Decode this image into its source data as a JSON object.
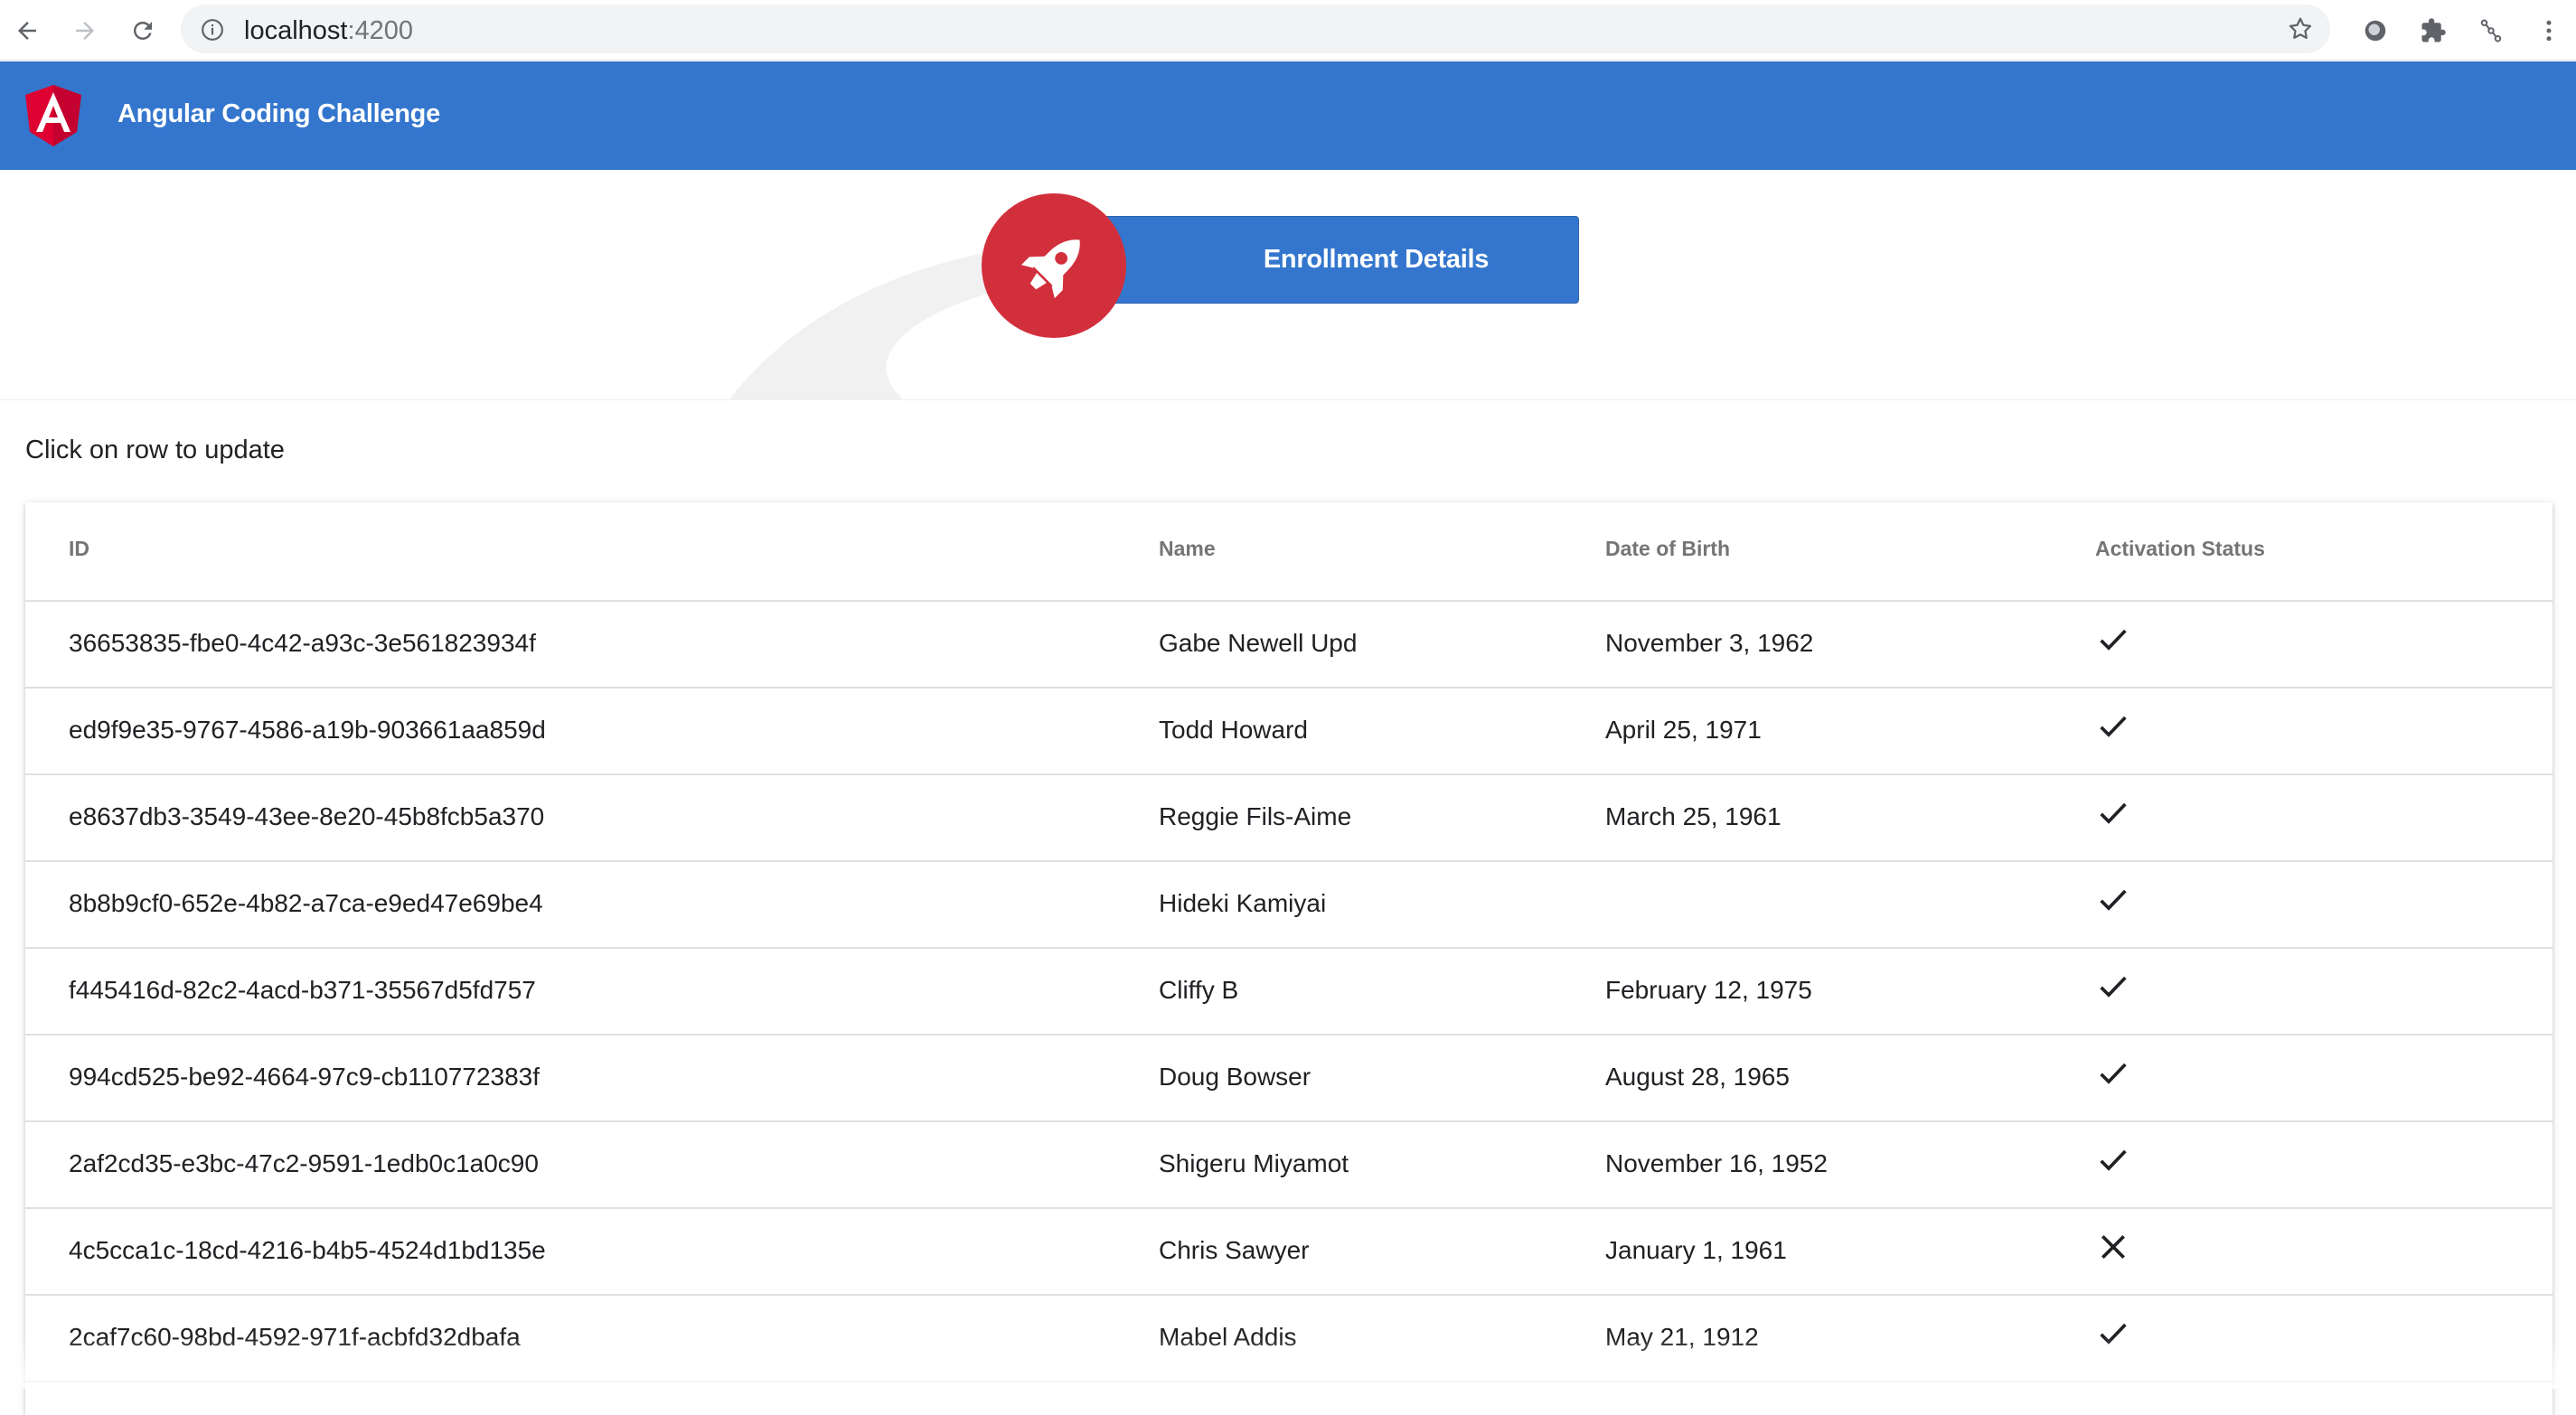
{
  "browser": {
    "url_host": "localhost",
    "url_port": ":4200"
  },
  "app": {
    "title": "Angular Coding Challenge",
    "logo_letter": "A",
    "brand_color": "#3476cd",
    "accent_color": "#d22f3c"
  },
  "hero": {
    "button_label": "Enrollment Details"
  },
  "hint": "Click on row to update",
  "table": {
    "headers": {
      "id": "ID",
      "name": "Name",
      "dob": "Date of Birth",
      "status": "Activation Status"
    },
    "rows": [
      {
        "id": "36653835-fbe0-4c42-a93c-3e561823934f",
        "name": "Gabe Newell Upd",
        "dob": "November 3, 1962",
        "active": true
      },
      {
        "id": "ed9f9e35-9767-4586-a19b-903661aa859d",
        "name": "Todd Howard",
        "dob": "April 25, 1971",
        "active": true
      },
      {
        "id": "e8637db3-3549-43ee-8e20-45b8fcb5a370",
        "name": "Reggie Fils-Aime",
        "dob": "March 25, 1961",
        "active": true
      },
      {
        "id": "8b8b9cf0-652e-4b82-a7ca-e9ed47e69be4",
        "name": "Hideki Kamiyai",
        "dob": "",
        "active": true
      },
      {
        "id": "f445416d-82c2-4acd-b371-35567d5fd757",
        "name": "Cliffy B",
        "dob": "February 12, 1975",
        "active": true
      },
      {
        "id": "994cd525-be92-4664-97c9-cb110772383f",
        "name": "Doug Bowser",
        "dob": "August 28, 1965",
        "active": true
      },
      {
        "id": "2af2cd35-e3bc-47c2-9591-1edb0c1a0c90",
        "name": "Shigeru Miyamot",
        "dob": "November 16, 1952",
        "active": true
      },
      {
        "id": "4c5cca1c-18cd-4216-b4b5-4524d1bd135e",
        "name": "Chris Sawyer",
        "dob": "January 1, 1961",
        "active": false
      },
      {
        "id": "2caf7c60-98bd-4592-971f-acbfd32dbafa",
        "name": "Mabel Addis",
        "dob": "May 21, 1912",
        "active": true
      }
    ]
  }
}
